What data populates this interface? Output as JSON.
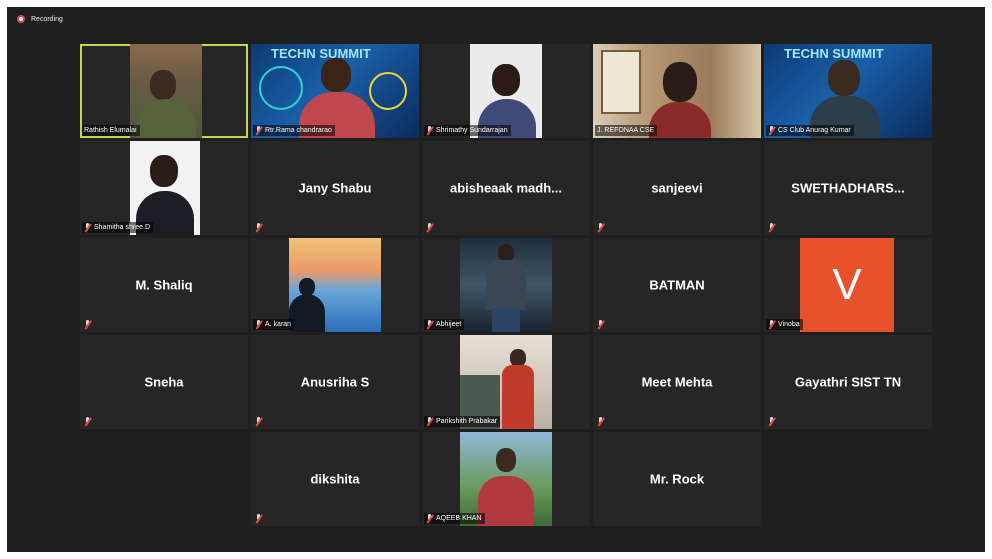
{
  "recording": {
    "label": "Recording"
  },
  "tiles": [
    {
      "name": "Rathish Elumalai"
    },
    {
      "name": "Rtr.Rama chandrarao"
    },
    {
      "name": "Shrimathy Sundarrajan"
    },
    {
      "name": "J. REFONAA CSE"
    },
    {
      "name": "CS Club Anurag Kumar"
    },
    {
      "name": "Shamitha shree.D"
    },
    {
      "name": "Jany Shabu"
    },
    {
      "name": "abisheaak  madh..."
    },
    {
      "name": "sanjeevi"
    },
    {
      "name": "SWETHADHARS..."
    },
    {
      "name": "M. Shaliq"
    },
    {
      "name": "A. karan"
    },
    {
      "name": "Abhijeet"
    },
    {
      "name": "BATMAN"
    },
    {
      "name": "Vinoba",
      "avatar_letter": "V"
    },
    {
      "name": "Sneha"
    },
    {
      "name": "Anusriha S"
    },
    {
      "name": "Parikshith Prabakar"
    },
    {
      "name": "Meet Mehta"
    },
    {
      "name": "Gayathri SIST TN"
    },
    {
      "name": "dikshita"
    },
    {
      "name": "AQEEB KHAN"
    },
    {
      "name": "Mr. Rock"
    }
  ],
  "banner": {
    "text": "TECHN  SUMMIT"
  },
  "colors": {
    "active_speaker": "#c8d64a",
    "muted_mic": "#e14b4b",
    "avatar_v": "#e8522a",
    "recording_dot": "#e04848"
  }
}
